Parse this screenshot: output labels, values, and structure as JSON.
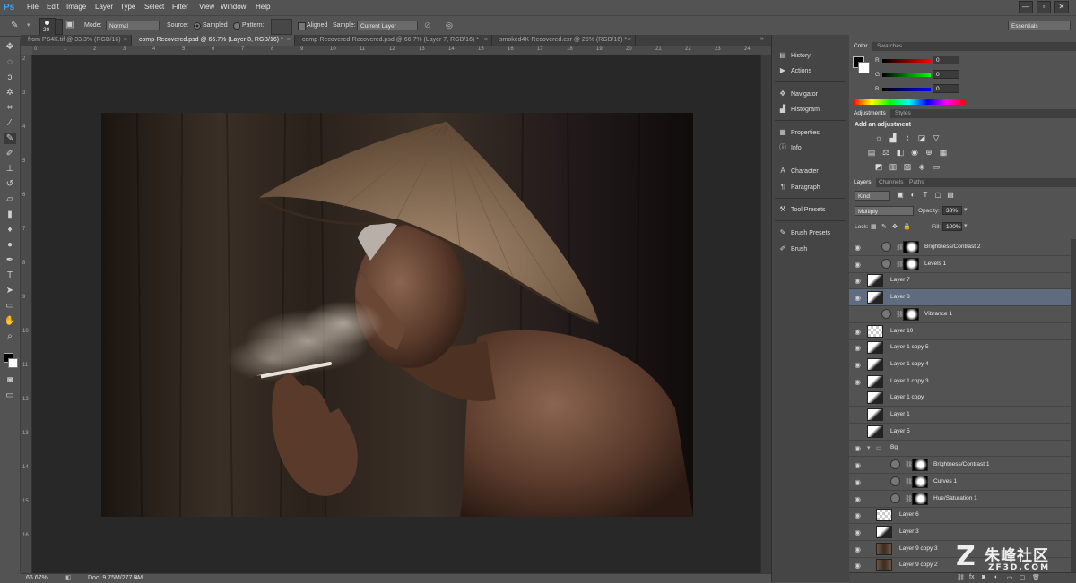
{
  "app": {
    "logo": "Ps",
    "menu": [
      "File",
      "Edit",
      "Image",
      "Layer",
      "Type",
      "Select",
      "Filter",
      "View",
      "Window",
      "Help"
    ],
    "window_controls": [
      "—",
      "▫",
      "✕"
    ],
    "workspace": "Essentials"
  },
  "options_bar": {
    "brush_size": "20",
    "mode_label": "Mode:",
    "mode_value": "Normal",
    "source_label": "Source:",
    "sampled_label": "Sampled",
    "pattern_label": "Pattern:",
    "aligned_label": "Aligned",
    "sample_label": "Sample:",
    "sample_value": "Current Layer"
  },
  "tabs": [
    {
      "label": "from PS4K.tif @ 33.3% (RGB/16)",
      "active": false
    },
    {
      "label": "comp-Recovered.psd @ 66.7% (Layer 8, RGB/16) *",
      "active": true
    },
    {
      "label": "comp-Recovered-Recovered.psd @ 66.7% (Layer 7, RGB/16) *",
      "active": false
    },
    {
      "label": "smoked4K-Recovered.exr @ 25% (RGB/16) *",
      "active": false
    }
  ],
  "ruler_top_labels": [
    "0",
    "1",
    "2",
    "3",
    "4",
    "5",
    "6",
    "7",
    "8",
    "9",
    "10",
    "11",
    "12",
    "13",
    "14",
    "15",
    "16",
    "17",
    "18",
    "19",
    "20",
    "21",
    "22",
    "23",
    "24"
  ],
  "ruler_left_labels": [
    "2",
    "3",
    "4",
    "5",
    "6",
    "7",
    "8",
    "9",
    "10",
    "11",
    "12",
    "13",
    "14",
    "15",
    "16"
  ],
  "status": {
    "zoom": "66.67%",
    "doc": "Doc: 9.75M/277.8M"
  },
  "dock": [
    {
      "label": "History",
      "icon": "history-icon",
      "glyph": "▤"
    },
    {
      "label": "Actions",
      "icon": "actions-icon",
      "glyph": "▶"
    },
    {
      "label": "Navigator",
      "icon": "navigator-icon",
      "glyph": "✥"
    },
    {
      "label": "Histogram",
      "icon": "histogram-icon",
      "glyph": "▟"
    },
    {
      "label": "Properties",
      "icon": "properties-icon",
      "glyph": "▦"
    },
    {
      "label": "Info",
      "icon": "info-icon",
      "glyph": "ⓘ"
    },
    {
      "label": "Character",
      "icon": "character-icon",
      "glyph": "A"
    },
    {
      "label": "Paragraph",
      "icon": "paragraph-icon",
      "glyph": "¶"
    },
    {
      "label": "Tool Presets",
      "icon": "tool-presets-icon",
      "glyph": "⚒"
    },
    {
      "label": "Brush Presets",
      "icon": "brush-presets-icon",
      "glyph": "✎"
    },
    {
      "label": "Brush",
      "icon": "brush-icon",
      "glyph": "✐"
    }
  ],
  "color_panel": {
    "tabs": [
      "Color",
      "Swatches"
    ],
    "r_label": "R",
    "g_label": "G",
    "b_label": "B",
    "r": "0",
    "g": "0",
    "b": "0"
  },
  "adjustments_panel": {
    "tabs": [
      "Adjustments",
      "Styles"
    ],
    "heading": "Add an adjustment"
  },
  "layers_panel": {
    "tabs": [
      "Layers",
      "Channels",
      "Paths"
    ],
    "kind": "Kind",
    "blend_mode": "Multiply",
    "opacity_label": "Opacity:",
    "opacity": "38%",
    "lock_label": "Lock:",
    "fill_label": "Fill:",
    "fill": "100%",
    "layers": [
      {
        "name": "Brightness/Contrast 2",
        "type": "adj",
        "indent": 1,
        "visible": true,
        "selected": false
      },
      {
        "name": "Levels 1",
        "type": "adj",
        "indent": 1,
        "visible": true,
        "selected": false
      },
      {
        "name": "Layer 7",
        "type": "pixel",
        "indent": 0,
        "visible": true,
        "selected": false
      },
      {
        "name": "Layer 8",
        "type": "pixel",
        "indent": 0,
        "visible": true,
        "selected": true
      },
      {
        "name": "Vibrance 1",
        "type": "adj",
        "indent": 1,
        "visible": false,
        "selected": false
      },
      {
        "name": "Layer 10",
        "type": "pixel",
        "indent": 0,
        "visible": true,
        "selected": false
      },
      {
        "name": "Layer 1 copy 5",
        "type": "pixel",
        "indent": 0,
        "visible": true,
        "selected": false
      },
      {
        "name": "Layer 1 copy 4",
        "type": "pixel",
        "indent": 0,
        "visible": true,
        "selected": false
      },
      {
        "name": "Layer 1 copy 3",
        "type": "pixel",
        "indent": 0,
        "visible": true,
        "selected": false
      },
      {
        "name": "Layer 1 copy",
        "type": "pixel",
        "indent": 0,
        "visible": false,
        "selected": false
      },
      {
        "name": "Layer 1",
        "type": "pixel",
        "indent": 0,
        "visible": false,
        "selected": false
      },
      {
        "name": "Layer 5",
        "type": "pixel",
        "indent": 0,
        "visible": false,
        "selected": false
      },
      {
        "name": "Bg",
        "type": "group",
        "indent": 0,
        "visible": true,
        "selected": false
      },
      {
        "name": "Brightness/Contrast 1",
        "type": "adj",
        "indent": 2,
        "visible": true,
        "selected": false
      },
      {
        "name": "Curves 1",
        "type": "adj",
        "indent": 2,
        "visible": true,
        "selected": false
      },
      {
        "name": "Hue/Saturation 1",
        "type": "adj",
        "indent": 2,
        "visible": true,
        "selected": false
      },
      {
        "name": "Layer 6",
        "type": "pixel",
        "indent": 1,
        "visible": true,
        "selected": false
      },
      {
        "name": "Layer 3",
        "type": "pixel",
        "indent": 1,
        "visible": true,
        "selected": false
      },
      {
        "name": "Layer 9 copy 3",
        "type": "pixel",
        "indent": 1,
        "visible": true,
        "selected": false
      },
      {
        "name": "Layer 9 copy 2",
        "type": "pixel",
        "indent": 1,
        "visible": true,
        "selected": false
      }
    ]
  },
  "watermark": {
    "cn": "朱峰社区",
    "en": "ZF3D.COM"
  }
}
